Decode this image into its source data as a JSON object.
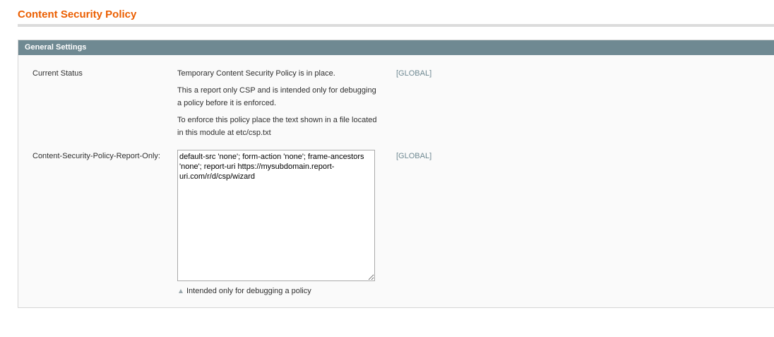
{
  "page": {
    "title": "Content Security Policy"
  },
  "section": {
    "header": "General Settings"
  },
  "rows": {
    "status": {
      "label": "Current Status",
      "lines": [
        "Temporary Content Security Policy is in place.",
        "This a report only CSP and is intended only for debugging a policy before it is enforced.",
        "To enforce this policy place the text shown in a file located in this module at etc/csp.txt"
      ],
      "scope": "[GLOBAL]"
    },
    "csp": {
      "label": "Content-Security-Policy-Report-Only:",
      "value": "default-src 'none'; form-action 'none'; frame-ancestors 'none'; report-uri https://mysubdomain.report-uri.com/r/d/csp/wizard",
      "note": "Intended only for debugging a policy",
      "scope": "[GLOBAL]"
    }
  },
  "colors": {
    "title": "#eb5e00",
    "section_header_bg": "#6f8992",
    "scope_text": "#6f8992"
  },
  "icons": {
    "note": "triangle-up-icon"
  }
}
